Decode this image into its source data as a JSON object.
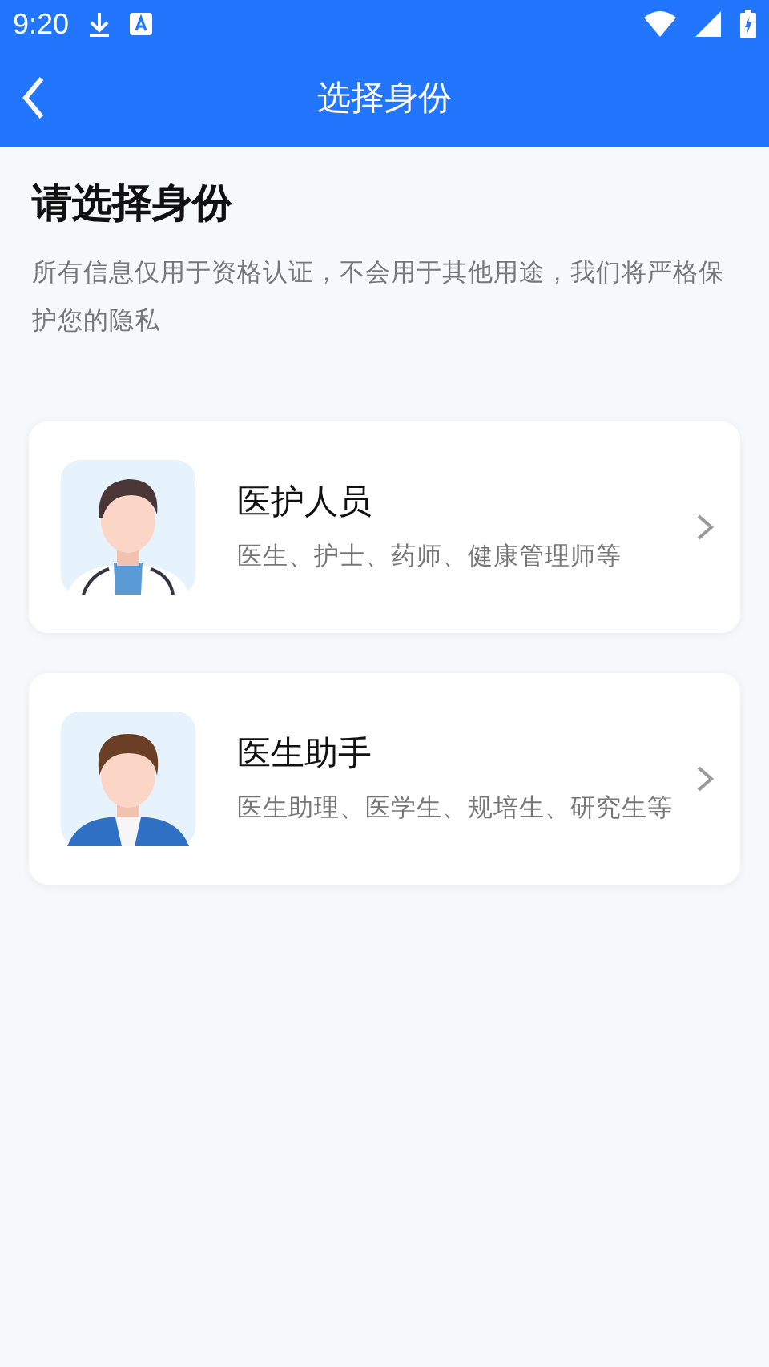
{
  "status_bar": {
    "time": "9:20"
  },
  "app_bar": {
    "title": "选择身份"
  },
  "heading": "请选择身份",
  "description": "所有信息仅用于资格认证，不会用于其他用途，我们将严格保护您的隐私",
  "roles": [
    {
      "kind": "doctor",
      "title": "医护人员",
      "subtitle": "医生、护士、药师、健康管理师等"
    },
    {
      "kind": "assistant",
      "title": "医生助手",
      "subtitle": "医生助理、医学生、规培生、研究生等"
    }
  ]
}
